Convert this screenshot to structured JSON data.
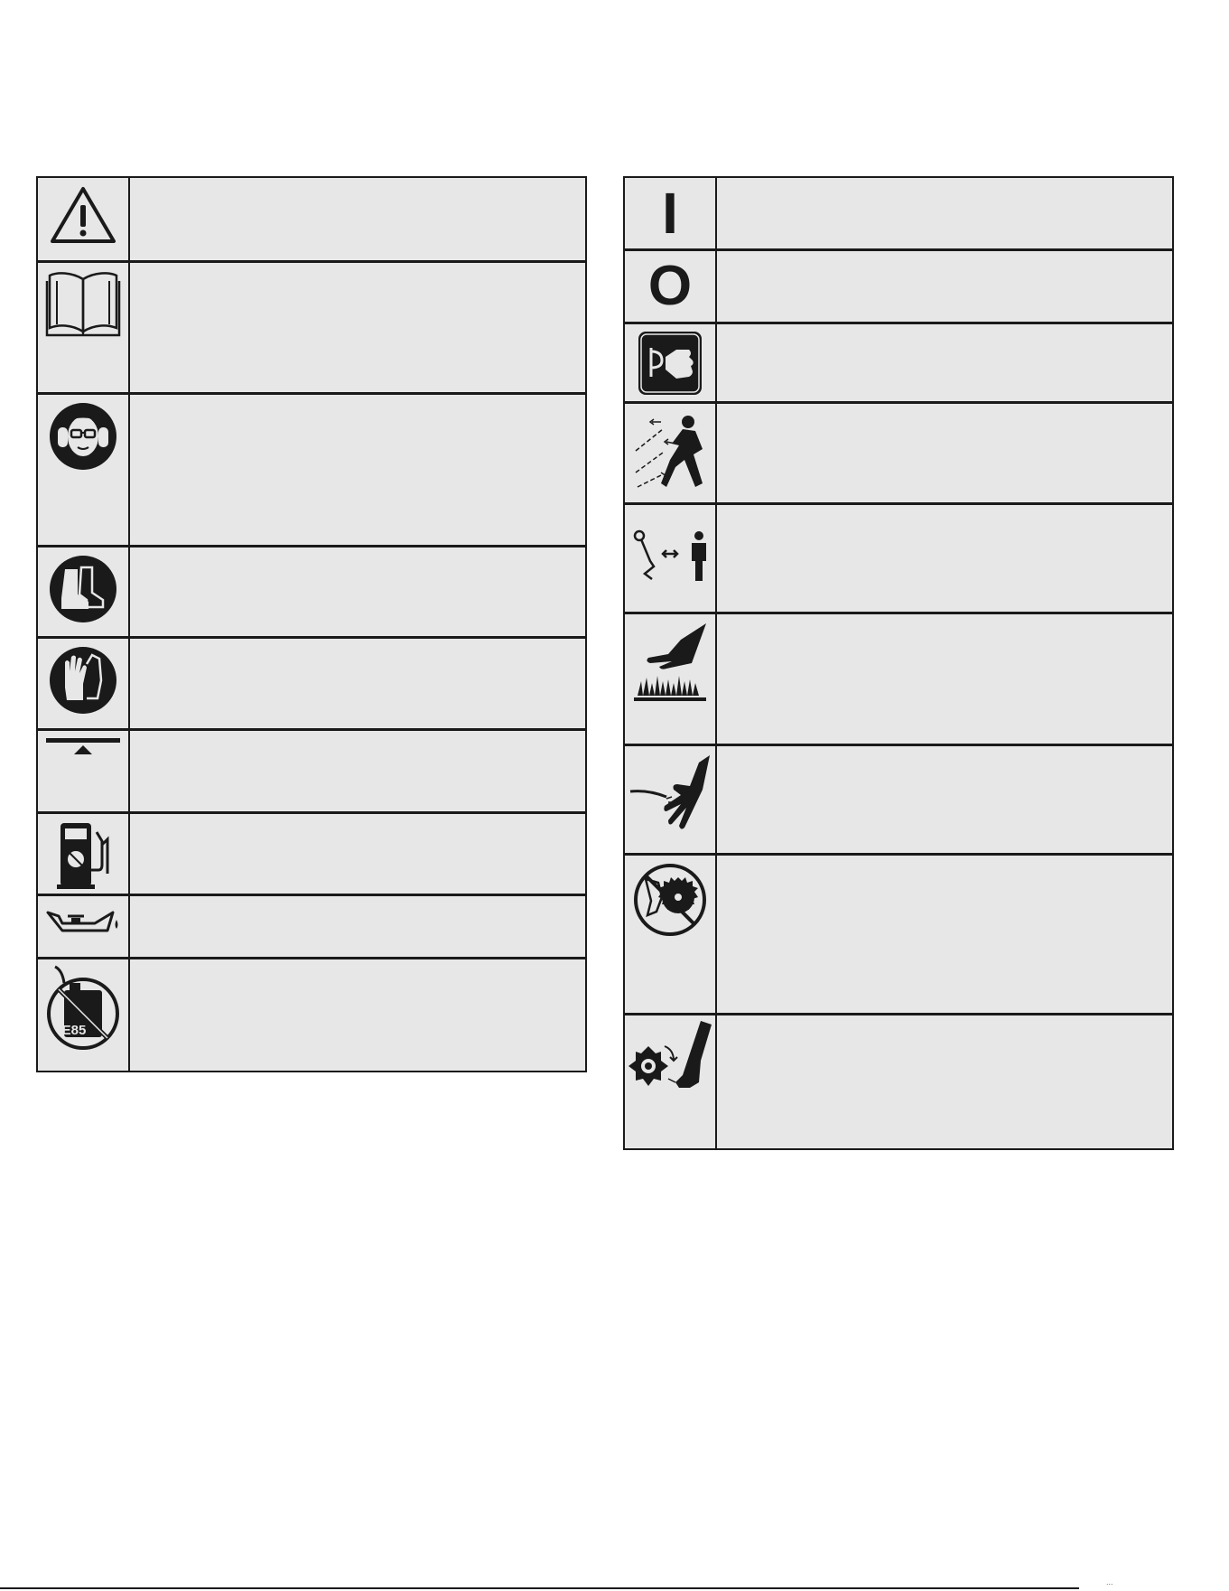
{
  "page": {
    "footer_text": "..."
  },
  "left_table": {
    "rows": [
      {
        "icon": "warning-triangle-icon",
        "description": ""
      },
      {
        "icon": "read-manual-icon",
        "description": ""
      },
      {
        "icon": "eye-ear-protection-icon",
        "description": ""
      },
      {
        "icon": "safety-boots-icon",
        "description": ""
      },
      {
        "icon": "gloves-icon",
        "description": ""
      },
      {
        "icon": "choke-lever-icon",
        "description": ""
      },
      {
        "icon": "fuel-pump-icon",
        "description": ""
      },
      {
        "icon": "oil-can-icon",
        "description": ""
      },
      {
        "icon": "no-e85-fuel-icon",
        "description": "",
        "icon_label": "E85"
      }
    ]
  },
  "right_table": {
    "rows": [
      {
        "icon": "on-switch-icon",
        "description": "",
        "icon_label": "I"
      },
      {
        "icon": "off-switch-icon",
        "description": "",
        "icon_label": "O"
      },
      {
        "icon": "primer-bulb-icon",
        "description": ""
      },
      {
        "icon": "thrown-objects-icon",
        "description": ""
      },
      {
        "icon": "keep-distance-icon",
        "description": ""
      },
      {
        "icon": "hot-surface-icon",
        "description": ""
      },
      {
        "icon": "line-cut-hand-icon",
        "description": ""
      },
      {
        "icon": "no-saw-blade-icon",
        "description": ""
      },
      {
        "icon": "blade-cut-foot-icon",
        "description": ""
      }
    ]
  }
}
